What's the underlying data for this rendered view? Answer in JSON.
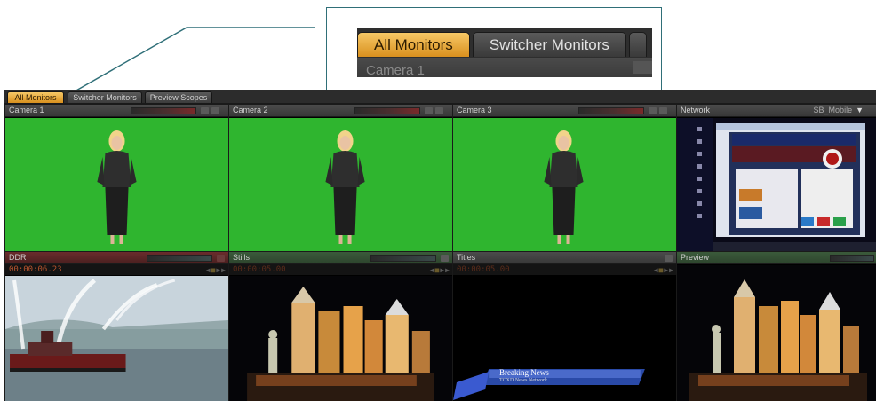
{
  "callout": {
    "tabs": [
      "All Monitors",
      "Switcher Monitors"
    ],
    "row_label": "Camera 1"
  },
  "tabs": [
    "All Monitors",
    "Switcher Monitors",
    "Preview Scopes"
  ],
  "active_tab": "All Monitors",
  "monitors": {
    "camera1": {
      "label": "Camera 1"
    },
    "camera2": {
      "label": "Camera 2"
    },
    "camera3": {
      "label": "Camera 3"
    },
    "network": {
      "label": "Network",
      "source": "SB_Mobile"
    },
    "ddr": {
      "label": "DDR",
      "timecode": "00:00:06.23"
    },
    "stills": {
      "label": "Stills",
      "timecode": "00:00:05.00"
    },
    "titles": {
      "label": "Titles",
      "timecode": "00:00:05.00"
    },
    "preview": {
      "label": "Preview"
    }
  },
  "lower_third": {
    "headline": "Breaking News",
    "subline": "TCXD News Network"
  },
  "colors": {
    "active_tab": "#f0b040",
    "green_screen": "#2fb52f",
    "callout_border": "#2f6f78"
  }
}
